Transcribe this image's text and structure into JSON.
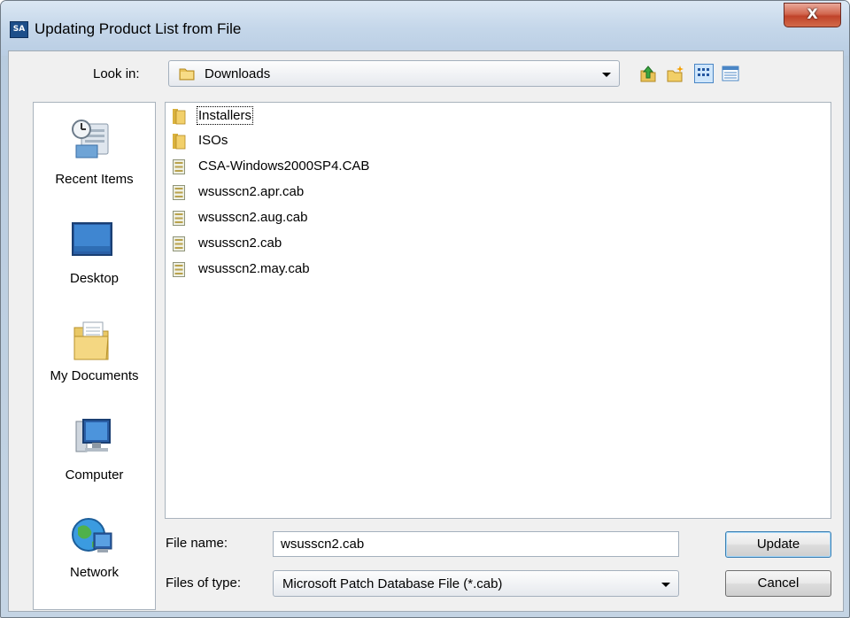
{
  "window": {
    "app_icon_text": "SA",
    "title": "Updating Product List from File",
    "close_glyph": "X"
  },
  "look_in": {
    "label": "Look in:",
    "value": "Downloads",
    "folder_icon": "folder-icon"
  },
  "toolbar": {
    "buttons": [
      "up-one-level-icon",
      "new-folder-icon",
      "list-view-icon",
      "details-view-icon"
    ]
  },
  "places": [
    {
      "label": "Recent Items",
      "icon": "recent-items-icon"
    },
    {
      "label": "Desktop",
      "icon": "desktop-icon"
    },
    {
      "label": "My Documents",
      "icon": "my-documents-icon"
    },
    {
      "label": "Computer",
      "icon": "computer-icon"
    },
    {
      "label": "Network",
      "icon": "network-icon"
    }
  ],
  "files": [
    {
      "name": "Installers",
      "type": "folder"
    },
    {
      "name": "ISOs",
      "type": "folder"
    },
    {
      "name": "CSA-Windows2000SP4.CAB",
      "type": "cab"
    },
    {
      "name": "wsusscn2.apr.cab",
      "type": "cab"
    },
    {
      "name": "wsusscn2.aug.cab",
      "type": "cab"
    },
    {
      "name": "wsusscn2.cab",
      "type": "cab"
    },
    {
      "name": "wsusscn2.may.cab",
      "type": "cab"
    }
  ],
  "file_name": {
    "label": "File name:",
    "value": "wsusscn2.cab"
  },
  "file_type": {
    "label": "Files of type:",
    "value": "Microsoft Patch Database File (*.cab)"
  },
  "buttons": {
    "update": "Update",
    "cancel": "Cancel"
  },
  "colors": {
    "title_bar": "#c5d7ea",
    "close_button": "#c0432a",
    "dialog_background": "#f0f0f0"
  }
}
